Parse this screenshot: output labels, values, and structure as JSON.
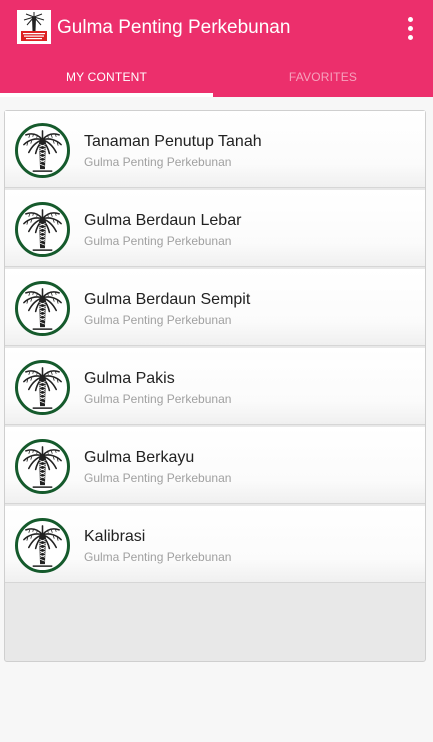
{
  "app": {
    "title": "Gulma Penting Perkebunan",
    "icon": "palm-tree-logo",
    "icon_text": "Gulma Penting Perkebunan",
    "accent_color": "#ec2f6c"
  },
  "menu": {
    "icon": "overflow-menu-icon"
  },
  "tabs": [
    {
      "label": "MY CONTENT",
      "selected": true
    },
    {
      "label": "FAVORITES",
      "selected": false
    }
  ],
  "items": [
    {
      "title": "Tanaman Penutup Tanah",
      "subtitle": "Gulma Penting Perkebunan",
      "icon": "palm-tree-icon"
    },
    {
      "title": "Gulma Berdaun Lebar",
      "subtitle": "Gulma Penting Perkebunan",
      "icon": "palm-tree-icon"
    },
    {
      "title": "Gulma Berdaun Sempit",
      "subtitle": "Gulma Penting Perkebunan",
      "icon": "palm-tree-icon"
    },
    {
      "title": "Gulma Pakis",
      "subtitle": "Gulma Penting Perkebunan",
      "icon": "palm-tree-icon"
    },
    {
      "title": "Gulma Berkayu",
      "subtitle": "Gulma Penting Perkebunan",
      "icon": "palm-tree-icon"
    },
    {
      "title": "Kalibrasi",
      "subtitle": "Gulma Penting Perkebunan",
      "icon": "palm-tree-icon"
    }
  ]
}
